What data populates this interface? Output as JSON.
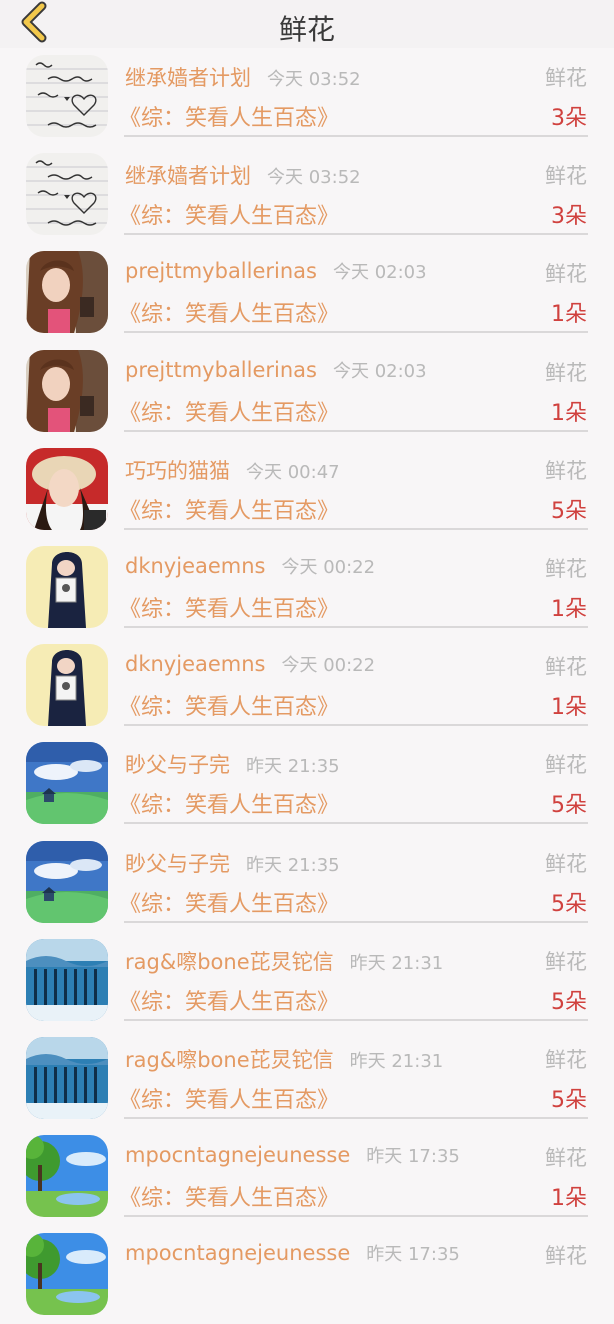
{
  "header": {
    "title": "鲜花",
    "back_icon": "chevron-left-icon",
    "back_color": "#f2c84b"
  },
  "rows": [
    {
      "name": "继承嫱者计划",
      "time": "今天 03:52",
      "label": "鲜花",
      "book": "《综：笑看人生百态》",
      "count": "3朵",
      "avatar": "handwriting"
    },
    {
      "name": "继承嫱者计划",
      "time": "今天 03:52",
      "label": "鲜花",
      "book": "《综：笑看人生百态》",
      "count": "3朵",
      "avatar": "handwriting"
    },
    {
      "name": "prejttmyballerinas",
      "time": "今天 02:03",
      "label": "鲜花",
      "book": "《综：笑看人生百态》",
      "count": "1朵",
      "avatar": "girl-brown"
    },
    {
      "name": "prejttmyballerinas",
      "time": "今天 02:03",
      "label": "鲜花",
      "book": "《综：笑看人生百态》",
      "count": "1朵",
      "avatar": "girl-brown"
    },
    {
      "name": "巧巧的猫猫",
      "time": "今天 00:47",
      "label": "鲜花",
      "book": "《综：笑看人生百态》",
      "count": "5朵",
      "avatar": "girl-hat"
    },
    {
      "name": "dknyjeaemns",
      "time": "今天 00:22",
      "label": "鲜花",
      "book": "《综：笑看人生百态》",
      "count": "1朵",
      "avatar": "girl-yellow"
    },
    {
      "name": "dknyjeaemns",
      "time": "今天 00:22",
      "label": "鲜花",
      "book": "《综：笑看人生百态》",
      "count": "1朵",
      "avatar": "girl-yellow"
    },
    {
      "name": "眇父与子完",
      "time": "昨天 21:35",
      "label": "鲜花",
      "book": "《综：笑看人生百态》",
      "count": "5朵",
      "avatar": "landscape-sky"
    },
    {
      "name": "眇父与子完",
      "time": "昨天 21:35",
      "label": "鲜花",
      "book": "《综：笑看人生百态》",
      "count": "5朵",
      "avatar": "landscape-sky"
    },
    {
      "name": "rag&嚓bone芘炅铊信",
      "time": "昨天 21:31",
      "label": "鲜花",
      "book": "《综：笑看人生百态》",
      "count": "5朵",
      "avatar": "blue-poem"
    },
    {
      "name": "rag&嚓bone芘炅铊信",
      "time": "昨天 21:31",
      "label": "鲜花",
      "book": "《综：笑看人生百态》",
      "count": "5朵",
      "avatar": "blue-poem"
    },
    {
      "name": "mpocntagnejeunesse",
      "time": "昨天 17:35",
      "label": "鲜花",
      "book": "《综：笑看人生百态》",
      "count": "1朵",
      "avatar": "tree-lake"
    },
    {
      "name": "mpocntagnejeunesse",
      "time": "昨天 17:35",
      "label": "鲜花",
      "book": "",
      "count": "",
      "avatar": "tree-lake"
    }
  ]
}
